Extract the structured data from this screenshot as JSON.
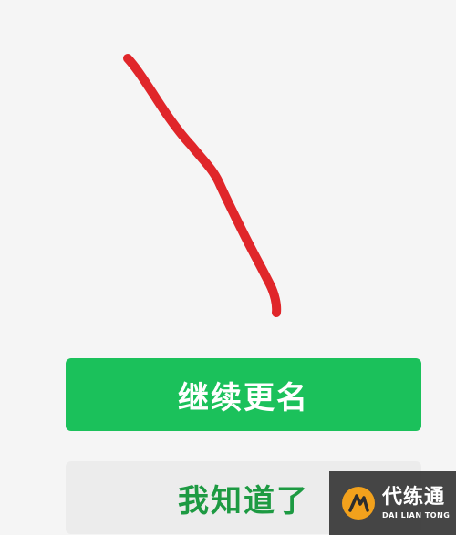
{
  "dialog": {
    "primary_button_label": "继续更名",
    "secondary_button_label": "我知道了"
  },
  "watermark": {
    "brand_cn": "代练通",
    "brand_en": "DAI LIAN TONG"
  },
  "colors": {
    "background": "#f5f5f5",
    "primary_button": "#1bc15b",
    "primary_text": "#ffffff",
    "secondary_button": "#ececec",
    "secondary_text": "#1d9a42",
    "annotation_stroke": "#e0262a",
    "logo_accent": "#f2a11c"
  },
  "icons": {
    "annotation": "hand-drawn-red-line",
    "watermark_logo": "daliantong-logo-icon"
  }
}
